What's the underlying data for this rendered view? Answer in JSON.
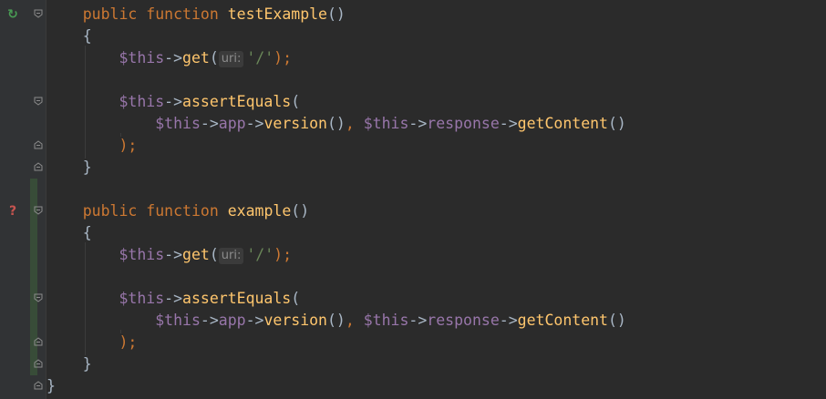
{
  "editor": {
    "lines": [
      {
        "gutter_marker": "run-test-icon",
        "fold": "fold-start",
        "changed": false,
        "tokens": [
          {
            "t": "    ",
            "c": "p"
          },
          {
            "t": "public",
            "c": "kw"
          },
          {
            "t": " ",
            "c": "p"
          },
          {
            "t": "function",
            "c": "kw"
          },
          {
            "t": " ",
            "c": "p"
          },
          {
            "t": "testExample",
            "c": "fn"
          },
          {
            "t": "()",
            "c": "p"
          }
        ]
      },
      {
        "gutter_marker": "",
        "fold": "",
        "changed": false,
        "tokens": [
          {
            "t": "    {",
            "c": "p"
          }
        ]
      },
      {
        "gutter_marker": "",
        "fold": "",
        "changed": false,
        "tokens": [
          {
            "t": "        ",
            "c": "p"
          },
          {
            "t": "$this",
            "c": "var"
          },
          {
            "t": "->",
            "c": "p"
          },
          {
            "t": "get",
            "c": "fn"
          },
          {
            "t": "(",
            "c": "p"
          },
          {
            "hint": "uri:"
          },
          {
            "t": "'/'",
            "c": "str"
          },
          {
            "t": ");",
            "c": "kw"
          }
        ]
      },
      {
        "gutter_marker": "",
        "fold": "",
        "changed": false,
        "tokens": []
      },
      {
        "gutter_marker": "",
        "fold": "fold-start",
        "changed": false,
        "tokens": [
          {
            "t": "        ",
            "c": "p"
          },
          {
            "t": "$this",
            "c": "var"
          },
          {
            "t": "->",
            "c": "p"
          },
          {
            "t": "assertEquals",
            "c": "fn"
          },
          {
            "t": "(",
            "c": "p"
          }
        ]
      },
      {
        "gutter_marker": "",
        "fold": "",
        "changed": false,
        "tokens": [
          {
            "t": "            ",
            "c": "p"
          },
          {
            "t": "$this",
            "c": "var"
          },
          {
            "t": "->",
            "c": "p"
          },
          {
            "t": "app",
            "c": "var"
          },
          {
            "t": "->",
            "c": "p"
          },
          {
            "t": "version",
            "c": "fn"
          },
          {
            "t": "()",
            "c": "p"
          },
          {
            "t": ", ",
            "c": "kw"
          },
          {
            "t": "$this",
            "c": "var"
          },
          {
            "t": "->",
            "c": "p"
          },
          {
            "t": "response",
            "c": "var"
          },
          {
            "t": "->",
            "c": "p"
          },
          {
            "t": "getContent",
            "c": "fn"
          },
          {
            "t": "()",
            "c": "p"
          }
        ]
      },
      {
        "gutter_marker": "",
        "fold": "fold-end",
        "changed": false,
        "tokens": [
          {
            "t": "        ",
            "c": "p"
          },
          {
            "t": ");",
            "c": "kw"
          }
        ]
      },
      {
        "gutter_marker": "",
        "fold": "fold-end",
        "changed": false,
        "tokens": [
          {
            "t": "    }",
            "c": "p"
          }
        ]
      },
      {
        "gutter_marker": "",
        "fold": "",
        "changed": true,
        "tokens": []
      },
      {
        "gutter_marker": "question-icon",
        "fold": "fold-start",
        "changed": true,
        "tokens": [
          {
            "t": "    ",
            "c": "p"
          },
          {
            "t": "public",
            "c": "kw"
          },
          {
            "t": " ",
            "c": "p"
          },
          {
            "t": "function",
            "c": "kw"
          },
          {
            "t": " ",
            "c": "p"
          },
          {
            "t": "example",
            "c": "fn"
          },
          {
            "t": "()",
            "c": "p"
          }
        ]
      },
      {
        "gutter_marker": "",
        "fold": "",
        "changed": true,
        "tokens": [
          {
            "t": "    {",
            "c": "p"
          }
        ]
      },
      {
        "gutter_marker": "",
        "fold": "",
        "changed": true,
        "tokens": [
          {
            "t": "        ",
            "c": "p"
          },
          {
            "t": "$this",
            "c": "var"
          },
          {
            "t": "->",
            "c": "p"
          },
          {
            "t": "get",
            "c": "fn"
          },
          {
            "t": "(",
            "c": "p"
          },
          {
            "hint": "uri:"
          },
          {
            "t": "'/'",
            "c": "str"
          },
          {
            "t": ");",
            "c": "kw"
          }
        ]
      },
      {
        "gutter_marker": "",
        "fold": "",
        "changed": true,
        "tokens": []
      },
      {
        "gutter_marker": "",
        "fold": "fold-start",
        "changed": true,
        "tokens": [
          {
            "t": "        ",
            "c": "p"
          },
          {
            "t": "$this",
            "c": "var"
          },
          {
            "t": "->",
            "c": "p"
          },
          {
            "t": "assertEquals",
            "c": "fn"
          },
          {
            "t": "(",
            "c": "p"
          }
        ]
      },
      {
        "gutter_marker": "",
        "fold": "",
        "changed": true,
        "tokens": [
          {
            "t": "            ",
            "c": "p"
          },
          {
            "t": "$this",
            "c": "var"
          },
          {
            "t": "->",
            "c": "p"
          },
          {
            "t": "app",
            "c": "var"
          },
          {
            "t": "->",
            "c": "p"
          },
          {
            "t": "version",
            "c": "fn"
          },
          {
            "t": "()",
            "c": "p"
          },
          {
            "t": ", ",
            "c": "kw"
          },
          {
            "t": "$this",
            "c": "var"
          },
          {
            "t": "->",
            "c": "p"
          },
          {
            "t": "response",
            "c": "var"
          },
          {
            "t": "->",
            "c": "p"
          },
          {
            "t": "getContent",
            "c": "fn"
          },
          {
            "t": "()",
            "c": "p"
          }
        ]
      },
      {
        "gutter_marker": "",
        "fold": "fold-end",
        "changed": true,
        "tokens": [
          {
            "t": "        ",
            "c": "p"
          },
          {
            "t": ");",
            "c": "kw"
          }
        ]
      },
      {
        "gutter_marker": "",
        "fold": "fold-end",
        "changed": true,
        "tokens": [
          {
            "t": "    }",
            "c": "p"
          }
        ]
      },
      {
        "gutter_marker": "",
        "fold": "fold-end",
        "changed": false,
        "tokens": [
          {
            "t": "}",
            "c": "p"
          }
        ]
      }
    ]
  }
}
